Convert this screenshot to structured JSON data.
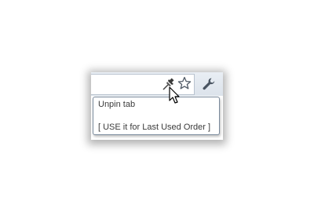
{
  "toolbar": {
    "icons": [
      "pin-icon",
      "star-icon",
      "wrench-icon"
    ]
  },
  "tooltip": {
    "title": "Unpin tab",
    "hint": "[ USE  it for Last Used Order ]"
  },
  "colors": {
    "toolbar_top": "#e9eef4",
    "toolbar_bottom": "#dce3eb",
    "tooltip_border": "#7a8a9c",
    "text": "#3b3b3b"
  }
}
